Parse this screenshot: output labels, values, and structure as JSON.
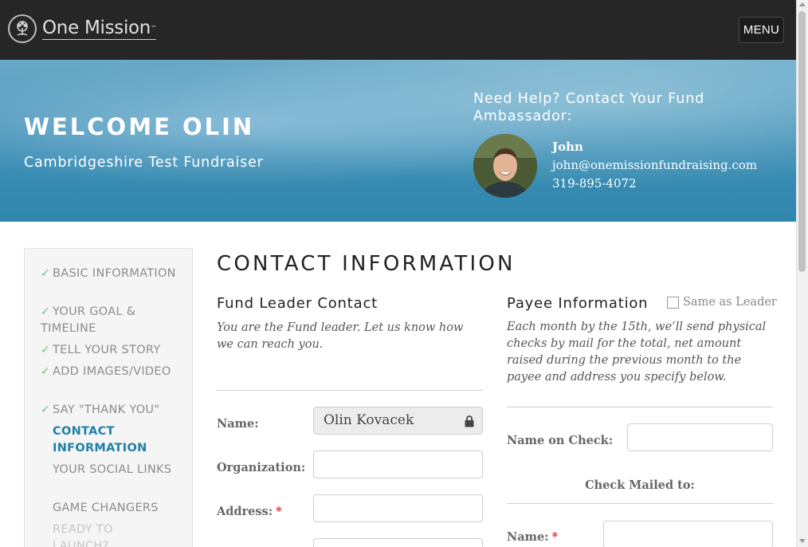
{
  "header": {
    "brand": "One Mission",
    "brand_mark": "™",
    "menu_label": "MENU"
  },
  "hero": {
    "welcome": "WELCOME OLIN",
    "fundraiser": "Cambridgeshire Test Fundraiser",
    "help_title": "Need Help? Contact Your Fund Ambassador:",
    "ambassador": {
      "name": "John",
      "email": "john@onemissionfundraising.com",
      "phone": "319-895-4072"
    }
  },
  "sidebar": {
    "items": [
      {
        "label": "BASIC INFORMATION",
        "state": "done"
      },
      {
        "label": "YOUR GOAL & TIMELINE",
        "state": "done"
      },
      {
        "label": "TELL YOUR STORY",
        "state": "done"
      },
      {
        "label": "ADD IMAGES/VIDEO",
        "state": "done"
      },
      {
        "label": "SAY \"THANK YOU\"",
        "state": "done"
      },
      {
        "label": "CONTACT INFORMATION",
        "state": "active"
      },
      {
        "label": "YOUR SOCIAL LINKS",
        "state": "todo"
      },
      {
        "label": "GAME CHANGERS",
        "state": "todo"
      },
      {
        "label": "READY TO LAUNCH?",
        "state": "disabled"
      }
    ]
  },
  "main": {
    "title": "CONTACT INFORMATION",
    "leader": {
      "title": "Fund Leader Contact",
      "description": "You are the Fund leader. Let us know how we can reach you.",
      "name_label": "Name:",
      "name_value": "Olin Kovacek",
      "organization_label": "Organization:",
      "organization_value": "",
      "address_label": "Address:",
      "address_value": "",
      "required_mark": "*"
    },
    "payee": {
      "title": "Payee Information",
      "same_as_leader_label": "Same as Leader",
      "same_as_leader_checked": false,
      "description": "Each month by the 15th, we’ll send physical checks by mail for the total, net amount raised during the previous month to the payee and address you specify below.",
      "name_on_check_label": "Name on Check:",
      "name_on_check_value": "",
      "check_mailed_label": "Check Mailed to:",
      "name_label": "Name:",
      "name_value": "",
      "required_mark": "*"
    }
  },
  "colors": {
    "topbar": "#262626",
    "accent": "#1f7fa6",
    "check": "#6fbf84",
    "required": "#d63030"
  }
}
